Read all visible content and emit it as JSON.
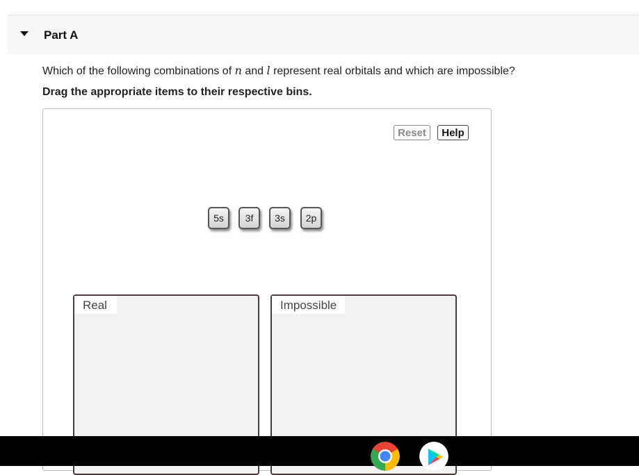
{
  "part": {
    "title": "Part A"
  },
  "question": {
    "prefix": "Which of the following combinations of ",
    "var_n": "n",
    "middle": " and ",
    "var_l": "l",
    "suffix": " represent real orbitals and which are impossible?"
  },
  "instruction": "Drag the appropriate items to their respective bins.",
  "toolbar": {
    "reset_label": "Reset",
    "help_label": "Help"
  },
  "items": [
    "5s",
    "3f",
    "3s",
    "2p"
  ],
  "bins": [
    {
      "label": "Real"
    },
    {
      "label": "Impossible"
    }
  ],
  "taskbar": {
    "apps": [
      "chrome-icon",
      "play-store-icon"
    ]
  }
}
